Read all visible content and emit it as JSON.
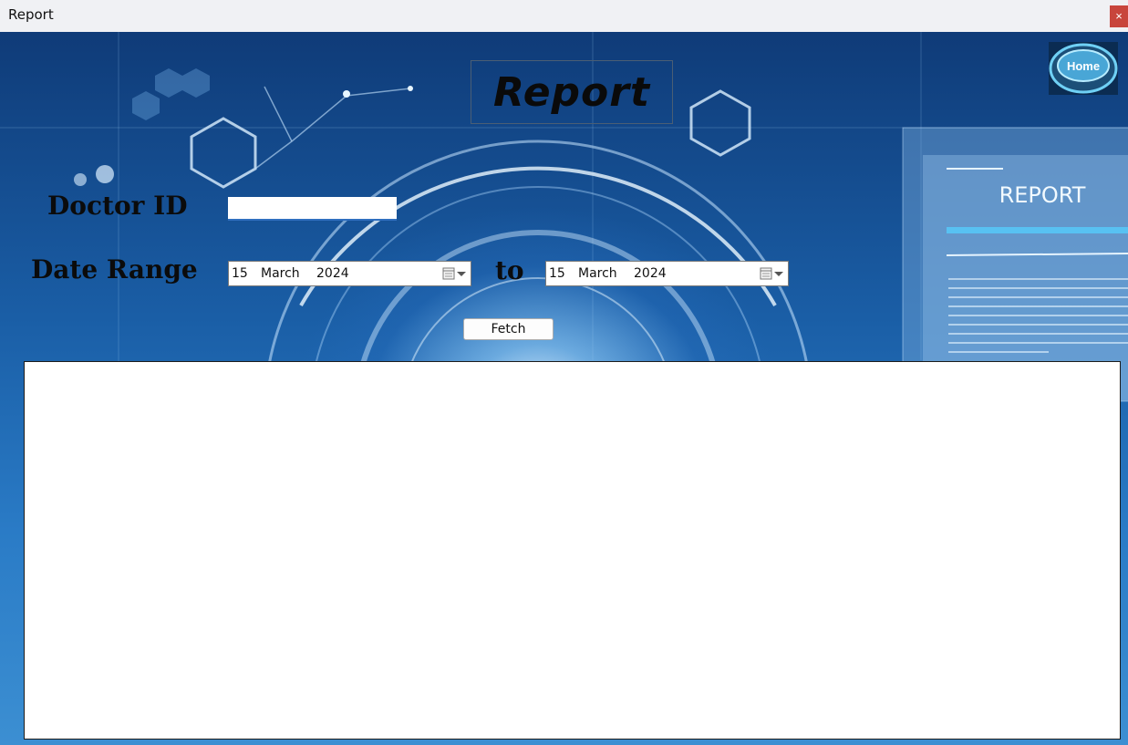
{
  "window": {
    "title": "Report",
    "close_glyph": "×"
  },
  "header": {
    "title": "Report"
  },
  "home_button": {
    "label": "Home"
  },
  "background_panel": {
    "label": "REPORT"
  },
  "form": {
    "doctor_label": "Doctor ID",
    "doctor_value": "",
    "range_label": "Date Range",
    "to_label": "to",
    "from_date": {
      "day": "15",
      "month": "March",
      "year": "2024"
    },
    "to_date": {
      "day": "15",
      "month": "March",
      "year": "2024"
    },
    "fetch_label": "Fetch"
  },
  "icons": {
    "calendar": "calendar-icon",
    "dropdown": "chevron-down-icon",
    "close": "close-icon"
  },
  "colors": {
    "titlebar": "#f0f1f4",
    "close_button": "#c8453c",
    "accent_underline": "#2f6fbf"
  }
}
